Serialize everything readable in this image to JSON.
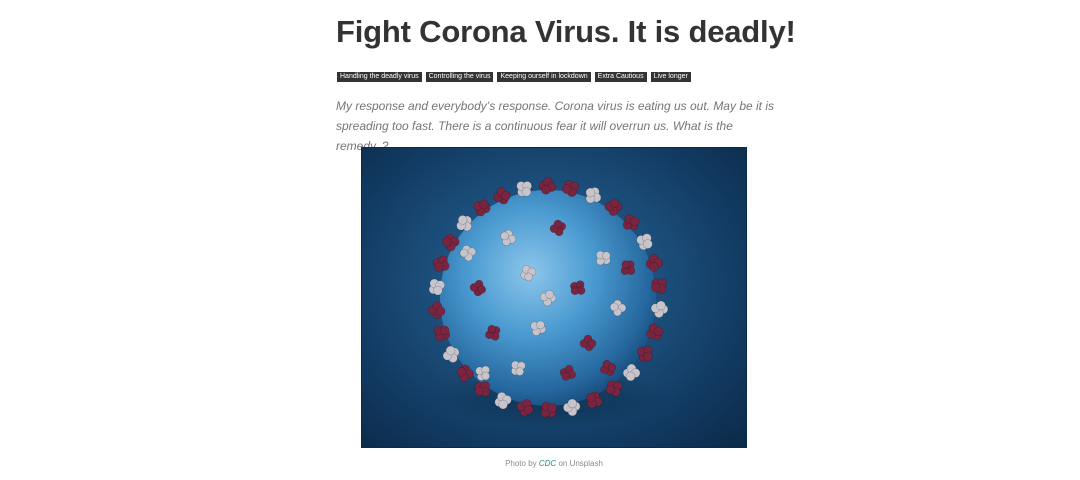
{
  "article": {
    "title": "Fight Corona Virus. It is deadly!",
    "tags": [
      "Handling the deadly virus",
      "Controlling the virus",
      "Keeping ourself in lockdown",
      "Extra Cautious",
      "Live longer"
    ],
    "lead": "My response and everybody’s response. Corona virus is eating us out. May be it is spreading too fast. There is a continuous fear it will overrun us. What is the remedy..?"
  },
  "image": {
    "subject": "coronavirus-illustration",
    "colors": {
      "background": "#123b63",
      "virus_body": "#4a9ad0",
      "spike_red": "#7a2540",
      "spike_white": "#c8c4cc"
    }
  },
  "caption": {
    "prefix": "Photo by",
    "author": "CDC",
    "suffix": "on Unsplash"
  }
}
